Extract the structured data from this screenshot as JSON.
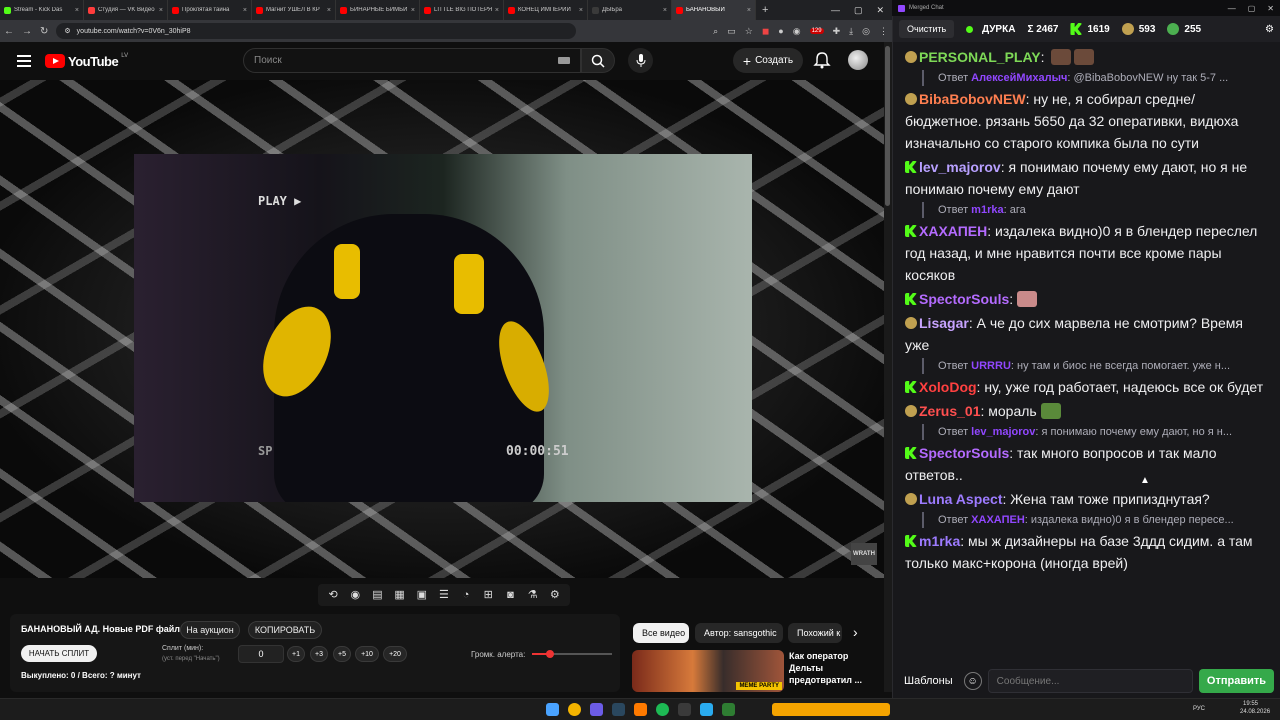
{
  "browser": {
    "tabs": [
      {
        "title": "Stream - Kick Das",
        "color": "#53fc18",
        "active": false
      },
      {
        "title": "Студия — VK Видео",
        "color": "#ff3c3c",
        "active": false
      },
      {
        "title": "Проклятая тайна",
        "color": "#ff0000",
        "active": false
      },
      {
        "title": "Магнит УШЁЛ В КР",
        "color": "#ff0000",
        "active": false
      },
      {
        "title": "БИНАРНЫЕ БИМБИ",
        "color": "#ff0000",
        "active": false
      },
      {
        "title": "LITTLE BIG ПОТЕРЯ",
        "color": "#ff0000",
        "active": false
      },
      {
        "title": "КОНЕЦ ИМПЕРИИ",
        "color": "#ff0000",
        "active": false
      },
      {
        "title": "ДЫЬра",
        "color": "#3a3a3a",
        "active": false
      },
      {
        "title": "БАНАНОВЫЙ",
        "color": "#ff0000",
        "active": true
      }
    ],
    "url": "youtube.com/watch?v=0V6n_30hiP8",
    "ext_count": "129"
  },
  "youtube": {
    "logo": "YouTube",
    "region": "LV",
    "search_placeholder": "Поиск",
    "create_label": "Создать"
  },
  "video": {
    "play_text": "PLAY ▶",
    "timecode": "00:00:51",
    "sp_text": "SP",
    "watermark": "WRATH"
  },
  "panel": {
    "title": "БАНАНОВЫЙ АД. Новые PDF файлы.",
    "auction_btn": "На аукцион",
    "copy_btn": "КОПИРОВАТЬ",
    "start_split_btn": "НАЧАТЬ СПЛИТ",
    "split_label": "Сплит (мин):",
    "split_sub": "(уст. перед \"Начать\")",
    "split_value": "0",
    "increments": [
      "+1",
      "+3",
      "+5",
      "+10",
      "+20"
    ],
    "volume_label": "Громк. алерта:",
    "volume_level": 0.22,
    "bought": "Выкуплено: 0 / Всего: ? минут"
  },
  "chips": [
    "Все видео",
    "Автор: sansgothic",
    "Похожий к"
  ],
  "recommended": {
    "title": "Как оператор Дельты предотвратил ...",
    "badge": "MEME PARTY"
  },
  "chat": {
    "window_title": "Merged Chat",
    "clear_btn": "Очистить",
    "channel": "ДУРКА",
    "stats": {
      "total": "Σ 2467",
      "kick": "1619",
      "mr": "593",
      "other": "255"
    },
    "messages": [
      {
        "type": "msg",
        "badge": "m",
        "user": "PERSONAL_PLAY",
        "color": "#7ed957",
        "text": " "
      },
      {
        "type": "reply",
        "user": "АлексейМихалыч",
        "text": " @BibaBobovNEW ну так 5-7 ..."
      },
      {
        "type": "msg",
        "badge": "m",
        "user": "BibaBobovNEW",
        "color": "#ff7f50",
        "text": " ну не, я собирал средне/бюджетное. рязань 5650 да 32 оперативки, видюха изначально со старого компика была по сути"
      },
      {
        "type": "msg",
        "badge": "k",
        "user": "lev_majorov",
        "color": "#b8a0ff",
        "text": " я понимаю почему ему дают, но я не понимаю почему ему дают"
      },
      {
        "type": "reply",
        "user": "m1rka",
        "text": " ага"
      },
      {
        "type": "msg",
        "badge": "k",
        "user": "ХАХАПЕН",
        "color": "#b46bff",
        "text": " издалека видно)0 я в блендер переслел год назад, и мне нравится почти все кроме пары косяков"
      },
      {
        "type": "msg",
        "badge": "k",
        "user": "SpectorSouls",
        "color": "#b46bff",
        "text": " "
      },
      {
        "type": "msg",
        "badge": "m",
        "user": "Lisagar",
        "color": "#c7a3ff",
        "text": " А че до сих марвела не смотрим? Время уже"
      },
      {
        "type": "reply",
        "user": "URRRU",
        "text": " ну там и биос не всегда помогает. уже н..."
      },
      {
        "type": "msg",
        "badge": "k",
        "user": "XoloDog",
        "color": "#ff4040",
        "text": " ну, уже год работает, надеюсь все ок будет"
      },
      {
        "type": "msg",
        "badge": "m",
        "user": "Zerus_01",
        "color": "#ff4f4f",
        "text": " мораль"
      },
      {
        "type": "reply",
        "user": "lev_majorov",
        "text": " я понимаю почему ему дают, но я н..."
      },
      {
        "type": "msg",
        "badge": "k",
        "user": "SpectorSouls",
        "color": "#b46bff",
        "text": " так много вопросов и так мало ответов.."
      },
      {
        "type": "msg",
        "badge": "m",
        "user": "Luna Aspect",
        "color": "#9d7bff",
        "text": " Жена там тоже припизднутая?"
      },
      {
        "type": "reply",
        "user": "ХАХАПЕН",
        "text": " издалека видно)0 я в блендер пересе..."
      },
      {
        "type": "msg",
        "badge": "k",
        "user": "m1rka",
        "color": "#9d7bff",
        "text": " мы ж дизайнеры на базе 3ддд сидим. а там только макс+корона (иногда врей)"
      }
    ],
    "templates_btn": "Шаблоны",
    "input_placeholder": "Сообщение...",
    "send_btn": "Отправить"
  },
  "taskbar": {
    "lang": "РУС",
    "time": "19:55",
    "date": "24.08.2026"
  }
}
